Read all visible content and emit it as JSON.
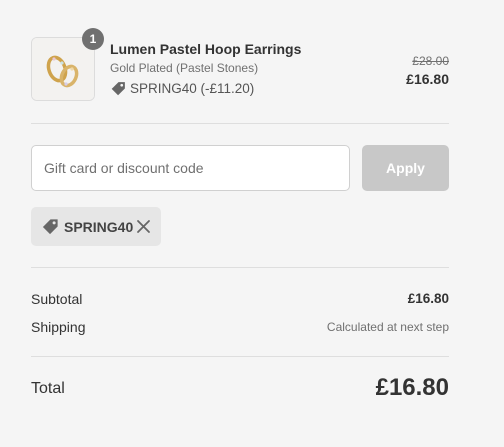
{
  "line_item": {
    "quantity": "1",
    "title": "Lumen Pastel Hoop Earrings",
    "variant": "Gold Plated (Pastel Stones)",
    "discount": "SPRING40 (-£11.20)",
    "compare_price": "£28.00",
    "price": "£16.80"
  },
  "discount_form": {
    "placeholder": "Gift card or discount code",
    "value": "",
    "apply_label": "Apply"
  },
  "applied_code": {
    "code": "SPRING40"
  },
  "summary": {
    "subtotal_label": "Subtotal",
    "subtotal_value": "£16.80",
    "shipping_label": "Shipping",
    "shipping_value": "Calculated at next step",
    "total_label": "Total",
    "total_value": "£16.80"
  },
  "colors": {
    "badge": "#707070",
    "apply_disabled": "#c8c8c8",
    "chip_bg": "#e6e6e6",
    "page_bg": "#f5f5f5"
  }
}
